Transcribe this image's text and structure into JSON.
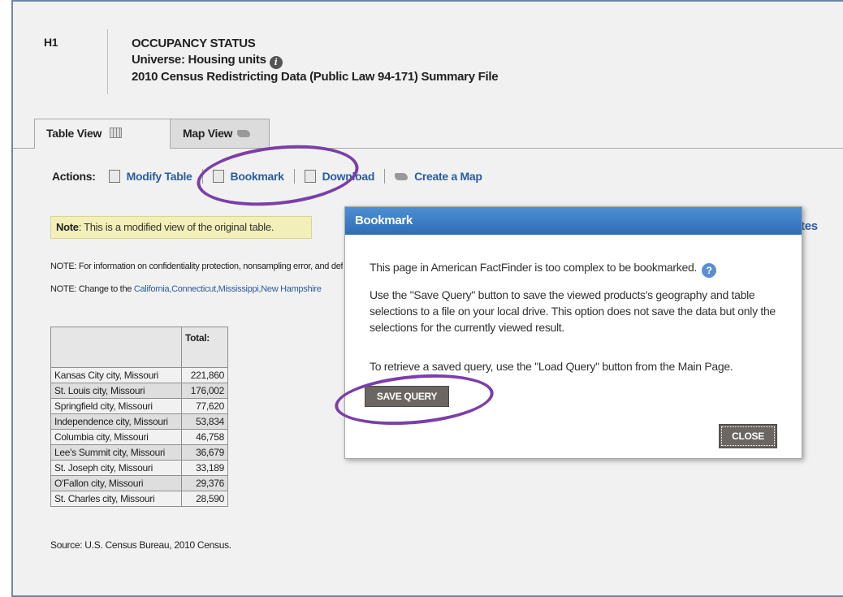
{
  "header": {
    "table_id": "H1",
    "title": "OCCUPANCY STATUS",
    "universe": "Universe: Housing units",
    "dataset": "2010 Census Redistricting Data (Public Law 94-171) Summary File"
  },
  "tabs": [
    {
      "label": "Table View",
      "icon": "grid-icon"
    },
    {
      "label": "Map View",
      "icon": "map-icon"
    }
  ],
  "actions": {
    "label": "Actions:",
    "items": [
      {
        "label": "Modify Table",
        "icon": "modify-table-icon"
      },
      {
        "label": "Bookmark",
        "icon": "bookmark-icon"
      },
      {
        "label": "Download",
        "icon": "download-icon"
      },
      {
        "label": "Create a Map",
        "icon": "map-icon"
      }
    ]
  },
  "notes": {
    "modified_bold": "Note",
    "modified_text": ": This is a modified view of the original table.",
    "note1": "NOTE: For information on confidentiality protection, nonsampling error, and definitions, see",
    "note2_prefix": "NOTE: Change to the ",
    "note2_link": "California,Connecticut,Mississippi,New Hampshire",
    "cut_link": "tes"
  },
  "data_table": {
    "header": "Total:",
    "rows": [
      {
        "place": "Kansas City city, Missouri",
        "total": "221,860"
      },
      {
        "place": "St. Louis city, Missouri",
        "total": "176,002"
      },
      {
        "place": "Springfield city, Missouri",
        "total": "77,620"
      },
      {
        "place": "Independence city, Missouri",
        "total": "53,834"
      },
      {
        "place": "Columbia city, Missouri",
        "total": "46,758"
      },
      {
        "place": "Lee's Summit city, Missouri",
        "total": "36,679"
      },
      {
        "place": "St. Joseph city, Missouri",
        "total": "33,189"
      },
      {
        "place": "O'Fallon city, Missouri",
        "total": "29,376"
      },
      {
        "place": "St. Charles city, Missouri",
        "total": "28,590"
      }
    ],
    "source": "Source: U.S. Census Bureau, 2010 Census."
  },
  "modal": {
    "title": "Bookmark",
    "line1": "This page in American FactFinder is too complex to be bookmarked.",
    "para2": "Use the \"Save Query\" button to save the viewed products's geography and table selections to a file on your local drive. This option does not save the data but only the selections for the currently viewed result.",
    "para3": "To retrieve a saved query, use the \"Load Query\" button from the Main Page.",
    "save_label": "SAVE QUERY",
    "close_label": "CLOSE"
  },
  "colors": {
    "highlight": "#7a3fa8",
    "link": "#2a5d9f",
    "modal_header": "#2f6db6",
    "button": "#6b6661"
  }
}
